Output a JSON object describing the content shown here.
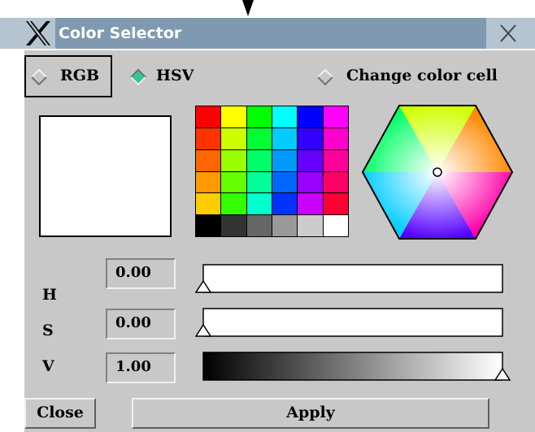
{
  "window": {
    "title": "Color Selector"
  },
  "mode": {
    "options": [
      {
        "label": "RGB",
        "selected": false
      },
      {
        "label": "HSV",
        "selected": true
      },
      {
        "label": "Change color cell",
        "selected": false
      }
    ]
  },
  "current_color": "#ffffff",
  "palette": [
    "#ff0000",
    "#ffff00",
    "#00ff00",
    "#00ffff",
    "#0000ff",
    "#ff00ff",
    "#ff3300",
    "#ccff00",
    "#00ff33",
    "#00ccff",
    "#3300ff",
    "#ff00cc",
    "#ff6600",
    "#99ff00",
    "#00ff66",
    "#0099ff",
    "#6600ff",
    "#ff0099",
    "#ff9900",
    "#66ff00",
    "#00ff99",
    "#0066ff",
    "#9900ff",
    "#ff0066",
    "#ffcc00",
    "#33ff00",
    "#00ffcc",
    "#0033ff",
    "#cc00ff",
    "#ff0033",
    "#000000",
    "#333333",
    "#666666",
    "#999999",
    "#cccccc",
    "#ffffff"
  ],
  "channels": [
    {
      "letter": "H",
      "value": "0.00",
      "level": 0
    },
    {
      "letter": "S",
      "value": "0.00",
      "level": 0
    },
    {
      "letter": "V",
      "value": "1.00",
      "level": 1
    }
  ],
  "buttons": {
    "close": "Close",
    "apply": "Apply"
  },
  "icons": {
    "app": "x-logo-icon",
    "close": "close-icon"
  }
}
